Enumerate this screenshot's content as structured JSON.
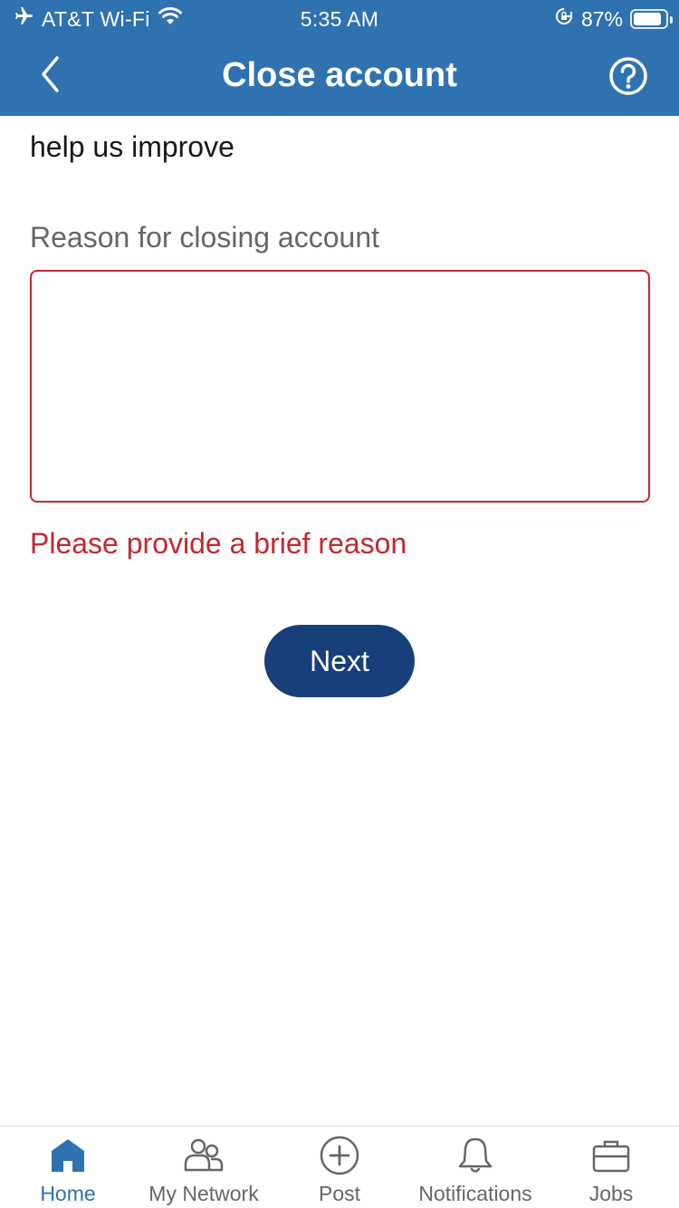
{
  "status_bar": {
    "carrier": "AT&T Wi-Fi",
    "time": "5:35 AM",
    "battery": "87%",
    "battery_level": 0.87,
    "icons": [
      "airplane-icon",
      "wifi-icon",
      "orientation-lock-icon",
      "battery-icon"
    ]
  },
  "header": {
    "title": "Close account",
    "back_icon": "chevron-left-icon",
    "help_icon": "help-icon"
  },
  "form": {
    "intro": "help us improve",
    "reason_label": "Reason for closing account",
    "reason_value": "",
    "error": "Please provide a brief reason",
    "next_label": "Next"
  },
  "tabbar": {
    "items": [
      {
        "label": "Home",
        "icon": "home-icon",
        "active": true
      },
      {
        "label": "My Network",
        "icon": "network-icon",
        "active": false
      },
      {
        "label": "Post",
        "icon": "post-icon",
        "active": false
      },
      {
        "label": "Notifications",
        "icon": "bell-icon",
        "active": false
      },
      {
        "label": "Jobs",
        "icon": "briefcase-icon",
        "active": false
      }
    ]
  },
  "colors": {
    "header_bg": "#2f72b0",
    "error": "#c2282f",
    "primary_button": "#17407a",
    "active_tab": "#2f72b0"
  }
}
